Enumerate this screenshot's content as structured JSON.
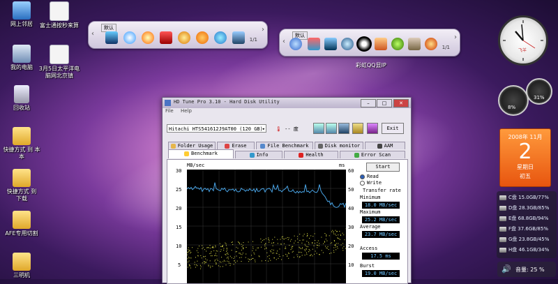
{
  "desktop": {
    "icons": [
      {
        "label": "网上邻居",
        "icon": "network-icon"
      },
      {
        "label": "富士通按秒来算",
        "icon": "document-icon"
      },
      {
        "label": "我的电脑",
        "icon": "computer-icon"
      },
      {
        "label": "3月5日太平洋电\n脑网北京镇",
        "icon": "document-icon"
      },
      {
        "label": "回收站",
        "icon": "recycle-bin-icon"
      },
      {
        "label": "快捷方式 到 本\n本",
        "icon": "folder-icon"
      },
      {
        "label": "快捷方式 到\n下载",
        "icon": "folder-icon"
      },
      {
        "label": "AFE专用切割",
        "icon": "folder-icon"
      },
      {
        "label": "三明机",
        "icon": "folder-icon"
      }
    ]
  },
  "toolbar_left": {
    "tag": "默认",
    "page": "1/1"
  },
  "toolbar_right": {
    "tag": "默认",
    "page": "1/1",
    "caption": "彩虹QQ显IP"
  },
  "window": {
    "title": "HD Tune Pro 3.10 - Hard Disk Utility",
    "menu": [
      "File",
      "Help"
    ],
    "drive": "Hitachi HTS541612J9AT00 (120 GB)",
    "temperature": "-- 度",
    "exit_label": "Exit",
    "tabs_top": [
      "Folder Usage",
      "Erase",
      "File Benchmark",
      "Disk monitor",
      "AAM"
    ],
    "tabs_bottom": [
      "Benchmark",
      "Info",
      "Health",
      "Error Scan"
    ],
    "active_tab": "Benchmark",
    "chart": {
      "left_unit": "MB/sec",
      "right_unit": "ms",
      "left_ticks": [
        "30",
        "25",
        "20",
        "15",
        "10",
        "5"
      ],
      "right_ticks": [
        "60",
        "50",
        "40",
        "30",
        "20",
        "10"
      ]
    },
    "controls": {
      "start_label": "Start",
      "read_label": "Read",
      "write_label": "Write",
      "transfer_rate_label": "Transfer rate",
      "minimum_label": "Minimum",
      "minimum_value": "18.0 MB/sec",
      "maximum_label": "Maximum",
      "maximum_value": "25.2 MB/sec",
      "average_label": "Average",
      "average_value": "23.7 MB/sec",
      "access_label": "Access",
      "access_value": "17.5 ms",
      "burst_label": "Burst",
      "burst_value": "19.0 MB/sec"
    }
  },
  "gadgets": {
    "clock_brand": "飞羊",
    "gauge_cpu": "8%",
    "gauge_mem": "31%",
    "calendar": {
      "year_month": "2008年 11月",
      "day": "2",
      "weekday": "星期日",
      "lunar": "初五"
    },
    "drives": [
      "C盘 15.0GB/77%",
      "D盘 28.3GB/85%",
      "E盘 68.8GB/94%",
      "F盘 37.6GB/85%",
      "G盘 23.8GB/45%",
      "H盘 46.1GB/34%"
    ],
    "volume": "音量: 25 %"
  }
}
